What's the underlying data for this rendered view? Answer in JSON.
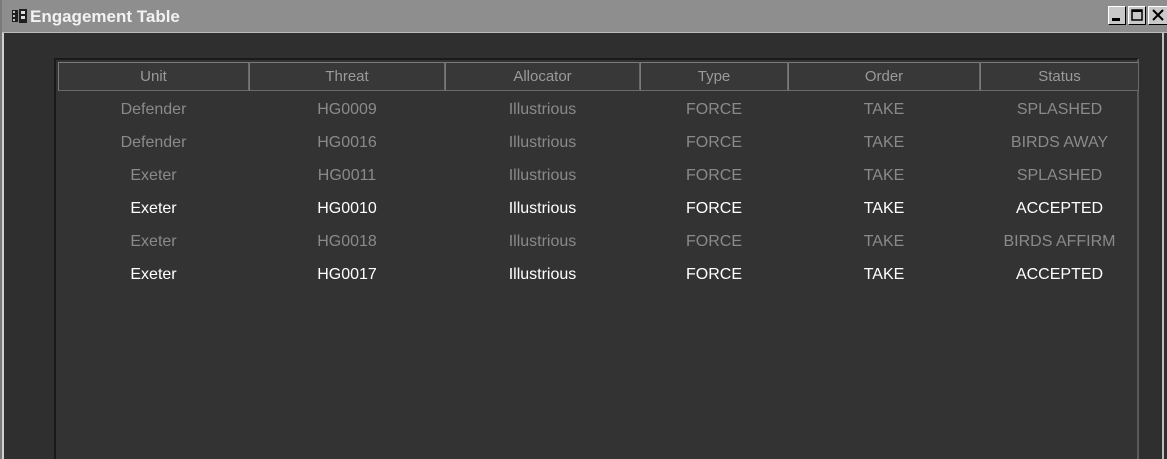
{
  "window": {
    "title": "Engagement Table",
    "icons": {
      "app": "table-icon",
      "minimize": "minimize-icon",
      "maximize": "maximize-icon",
      "close": "close-icon"
    }
  },
  "table": {
    "columns": [
      "Unit",
      "Threat",
      "Allocator",
      "Type",
      "Order",
      "Status"
    ],
    "rows": [
      {
        "state": "dim",
        "cells": [
          "Defender",
          "HG0009",
          "Illustrious",
          "FORCE",
          "TAKE",
          "SPLASHED"
        ]
      },
      {
        "state": "dim",
        "cells": [
          "Defender",
          "HG0016",
          "Illustrious",
          "FORCE",
          "TAKE",
          "BIRDS AWAY"
        ]
      },
      {
        "state": "dim",
        "cells": [
          "Exeter",
          "HG0011",
          "Illustrious",
          "FORCE",
          "TAKE",
          "SPLASHED"
        ]
      },
      {
        "state": "bright",
        "cells": [
          "Exeter",
          "HG0010",
          "Illustrious",
          "FORCE",
          "TAKE",
          "ACCEPTED"
        ]
      },
      {
        "state": "dim",
        "cells": [
          "Exeter",
          "HG0018",
          "Illustrious",
          "FORCE",
          "TAKE",
          "BIRDS AFFIRM"
        ]
      },
      {
        "state": "bright",
        "cells": [
          "Exeter",
          "HG0017",
          "Illustrious",
          "FORCE",
          "TAKE",
          "ACCEPTED"
        ]
      }
    ]
  },
  "colors": {
    "background": "#2f2f2f",
    "titlebar": "#8e8e8e",
    "text_active": "#ffffff",
    "text_dim": "#8a8a8a"
  }
}
